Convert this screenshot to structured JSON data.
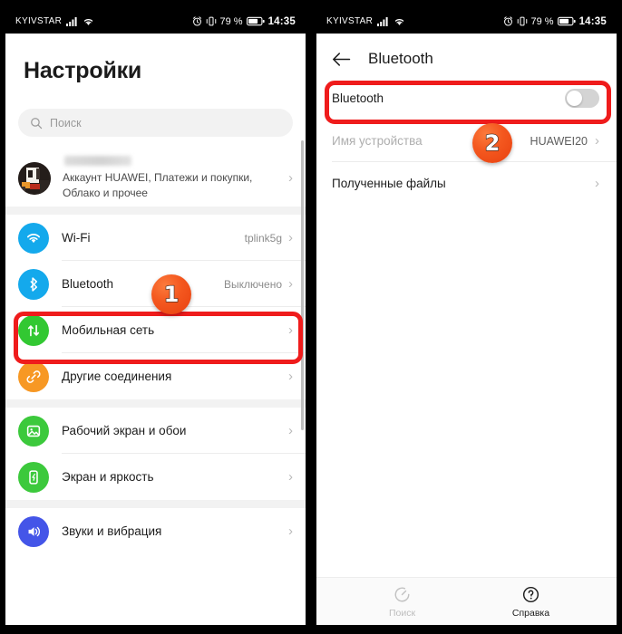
{
  "statusbar": {
    "carrier": "KYIVSTAR",
    "signal_icon": "signal-bars-icon",
    "wifi_icon": "wifi-icon",
    "alarm_icon": "alarm-icon",
    "vibrate_icon": "vibrate-icon",
    "battery_percent": "79 %",
    "battery_icon": "battery-icon",
    "time": "14:35"
  },
  "settings_screen": {
    "title": "Настройки",
    "search": {
      "placeholder": "Поиск",
      "icon": "search-icon"
    },
    "account": {
      "name_redacted": "",
      "subtitle": "Аккаунт HUAWEI, Платежи и покупки, Облако и прочее",
      "avatar_icon": "avatar",
      "chevron": "›"
    },
    "items": [
      {
        "label": "Wi-Fi",
        "value": "tplink5g",
        "icon": "wifi-icon",
        "color": "#14a9ec",
        "chevron": "›"
      },
      {
        "label": "Bluetooth",
        "value": "Выключено",
        "icon": "bluetooth-icon",
        "color": "#14a9ec",
        "chevron": "›"
      },
      {
        "label": "Мобильная сеть",
        "value": "",
        "icon": "mobile-network-icon",
        "color": "#32c832",
        "chevron": "›"
      },
      {
        "label": "Другие соединения",
        "value": "",
        "icon": "link-icon",
        "color": "#f79824",
        "chevron": "›"
      },
      {
        "label": "Рабочий экран и обои",
        "value": "",
        "icon": "wallpaper-icon",
        "color": "#3cc93c",
        "chevron": "›"
      },
      {
        "label": "Экран и яркость",
        "value": "",
        "icon": "display-brightness-icon",
        "color": "#3cc93c",
        "chevron": "›"
      },
      {
        "label": "Звуки и вибрация",
        "value": "",
        "icon": "sound-icon",
        "color": "#4455e8",
        "chevron": "›"
      }
    ]
  },
  "bluetooth_screen": {
    "back_icon": "back-arrow-icon",
    "title": "Bluetooth",
    "toggle_row": {
      "label": "Bluetooth",
      "state": "off"
    },
    "device_name_row": {
      "label": "Имя устройства",
      "value": "HUAWEI20",
      "chevron": "›"
    },
    "received_files_row": {
      "label": "Полученные файлы",
      "value": "",
      "chevron": "›"
    },
    "bottombar": [
      {
        "label": "Поиск",
        "icon": "scan-icon",
        "enabled": false
      },
      {
        "label": "Справка",
        "icon": "help-icon",
        "enabled": true
      }
    ]
  },
  "annotations": {
    "highlight_color": "#ef1c1c",
    "badges": [
      {
        "number": "1",
        "target": "bluetooth-settings-row"
      },
      {
        "number": "2",
        "target": "bluetooth-toggle"
      }
    ]
  }
}
